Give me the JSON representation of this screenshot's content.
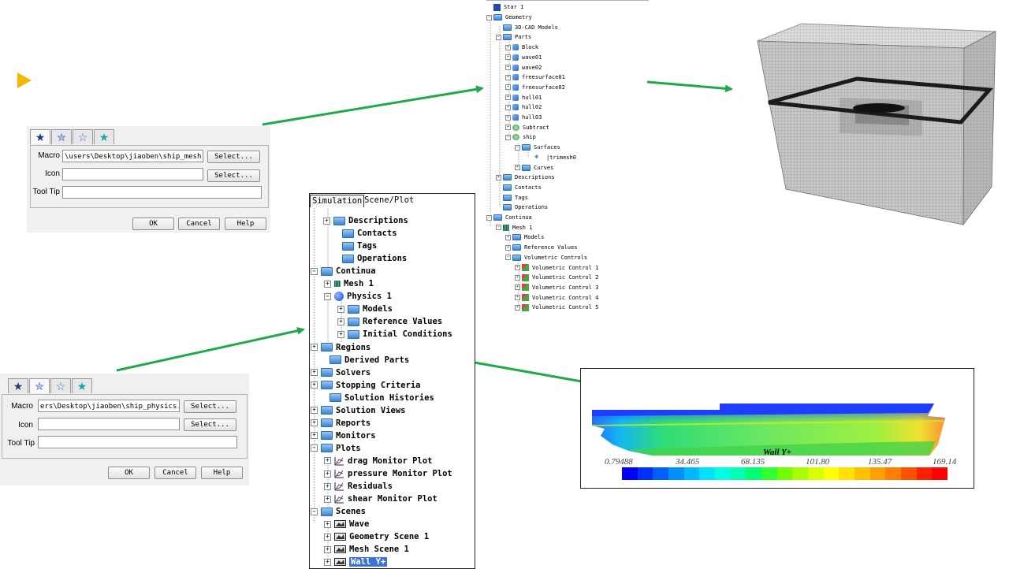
{
  "dialog_mesh": {
    "macro_label": "Macro",
    "macro_value": "\\users\\Desktop\\jiaoben\\ship_mesh.java",
    "icon_label": "Icon",
    "icon_value": "",
    "tooltip_label": "Tool Tip",
    "tooltip_value": "",
    "select_label": "Select...",
    "ok_label": "OK",
    "cancel_label": "Cancel",
    "help_label": "Help"
  },
  "dialog_physics": {
    "macro_label": "Macro",
    "macro_value": "ers\\Desktop\\jiaoben\\ship_physics.java",
    "icon_label": "Icon",
    "icon_value": "",
    "tooltip_label": "Tool Tip",
    "tooltip_value": "",
    "select_label": "Select...",
    "ok_label": "OK",
    "cancel_label": "Cancel",
    "help_label": "Help"
  },
  "geometry_tree": {
    "items": [
      {
        "label": "Star 1"
      },
      {
        "label": "Geometry"
      },
      {
        "label": "3D-CAD Models"
      },
      {
        "label": "Parts"
      },
      {
        "label": "Block"
      },
      {
        "label": "wave01"
      },
      {
        "label": "wave02"
      },
      {
        "label": "freesurface01"
      },
      {
        "label": "freesurface02"
      },
      {
        "label": "hull01"
      },
      {
        "label": "hull02"
      },
      {
        "label": "hull03"
      },
      {
        "label": "Subtract"
      },
      {
        "label": "ship"
      },
      {
        "label": "Surfaces"
      },
      {
        "label": "|trimesh0"
      },
      {
        "label": "Curves"
      },
      {
        "label": "Descriptions"
      },
      {
        "label": "Contacts"
      },
      {
        "label": "Tags"
      },
      {
        "label": "Operations"
      },
      {
        "label": "Continua"
      },
      {
        "label": "Mesh 1"
      },
      {
        "label": "Models"
      },
      {
        "label": "Reference Values"
      },
      {
        "label": "Volumetric Controls"
      },
      {
        "label": "Volumetric Control 1"
      },
      {
        "label": "Volumetric Control 2"
      },
      {
        "label": "Volumetric Control 3"
      },
      {
        "label": "Volumetric Control 4"
      },
      {
        "label": "Volumetric Control 5"
      }
    ]
  },
  "simulation_tree": {
    "tabs": [
      {
        "label": "Simulation"
      },
      {
        "label": "Scene/Plot"
      }
    ],
    "items": [
      {
        "label": "Descriptions"
      },
      {
        "label": "Contacts"
      },
      {
        "label": "Tags"
      },
      {
        "label": "Operations"
      },
      {
        "label": "Continua"
      },
      {
        "label": "Mesh 1"
      },
      {
        "label": "Physics 1"
      },
      {
        "label": "Models"
      },
      {
        "label": "Reference Values"
      },
      {
        "label": "Initial Conditions"
      },
      {
        "label": "Regions"
      },
      {
        "label": "Derived Parts"
      },
      {
        "label": "Solvers"
      },
      {
        "label": "Stopping Criteria"
      },
      {
        "label": "Solution Histories"
      },
      {
        "label": "Solution Views"
      },
      {
        "label": "Reports"
      },
      {
        "label": "Monitors"
      },
      {
        "label": "Plots"
      },
      {
        "label": "drag Monitor Plot"
      },
      {
        "label": "pressure Monitor Plot"
      },
      {
        "label": "Residuals"
      },
      {
        "label": "shear Monitor Plot"
      },
      {
        "label": "Scenes"
      },
      {
        "label": "Wave"
      },
      {
        "label": "Geometry Scene 1"
      },
      {
        "label": "Mesh Scene 1"
      },
      {
        "label": "Wall Y+"
      }
    ]
  },
  "wally_scene": {
    "title": "Wall Y+",
    "ticks": [
      "0.79488",
      "34.465",
      "68.135",
      "101.80",
      "135.47",
      "169.14"
    ],
    "colormap": [
      "#0000ff",
      "#0030ff",
      "#0060ff",
      "#0090ff",
      "#00b8ff",
      "#00e0ff",
      "#00ffe0",
      "#00ffb0",
      "#00ff70",
      "#30ff30",
      "#70ff00",
      "#a8ff00",
      "#d8ff00",
      "#ffff00",
      "#ffe000",
      "#ffc000",
      "#ffa000",
      "#ff8000",
      "#ff5000",
      "#ff2000",
      "#ff0000"
    ]
  },
  "colors": {
    "arrow": "#1faa4a",
    "bullet": "#f2b800",
    "selection": "#3a72d8"
  }
}
